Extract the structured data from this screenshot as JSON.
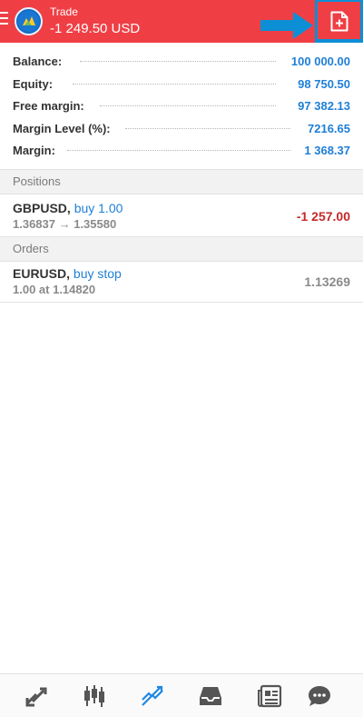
{
  "header": {
    "title": "Trade",
    "profit": "-1 249.50 USD",
    "menu_icon": "hamburger-menu-icon",
    "logo_icon": "metatrader-logo-icon",
    "add_icon": "new-order-icon",
    "highlight_color": "#0d8fd6",
    "header_color": "#ef3f45"
  },
  "account": {
    "rows": [
      {
        "label": "Balance:",
        "value": "100 000.00"
      },
      {
        "label": "Equity:",
        "value": "98 750.50"
      },
      {
        "label": "Free margin:",
        "value": "97 382.13"
      },
      {
        "label": "Margin Level (%):",
        "value": "7216.65"
      },
      {
        "label": "Margin:",
        "value": "1 368.37"
      }
    ]
  },
  "positions": {
    "header": "Positions",
    "items": [
      {
        "symbol": "GBPUSD,",
        "action": "buy 1.00",
        "detail": "1.36837 → 1.35580",
        "value": "-1 257.00"
      }
    ]
  },
  "orders": {
    "header": "Orders",
    "items": [
      {
        "symbol": "EURUSD,",
        "action": "buy stop",
        "detail": "1.00 at 1.14820",
        "value": "1.13269"
      }
    ]
  },
  "nav": {
    "items": [
      {
        "icon": "quotes-icon"
      },
      {
        "icon": "chart-icon"
      },
      {
        "icon": "trade-icon",
        "active": true
      },
      {
        "icon": "history-icon"
      },
      {
        "icon": "news-icon"
      },
      {
        "icon": "chat-icon"
      }
    ]
  }
}
